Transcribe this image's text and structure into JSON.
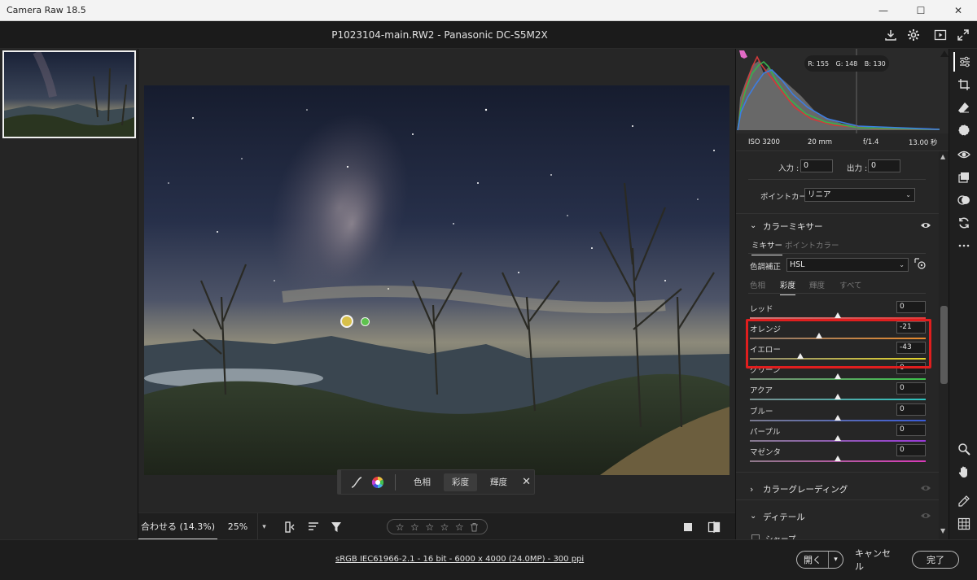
{
  "window": {
    "title": "Camera Raw 18.5",
    "controls": [
      "—",
      "☐",
      "✕"
    ]
  },
  "header": {
    "file_title": "P1023104-main.RW2  -  Panasonic DC-S5M2X"
  },
  "histogram": {
    "readout": {
      "r": "R: 155",
      "g": "G: 148",
      "b": "B: 130"
    },
    "colors": {
      "red": "#d23a3a",
      "green": "#37b24d",
      "blue": "#3d7de0",
      "fill": "#9a9a9a"
    }
  },
  "exif": {
    "iso": "ISO 3200",
    "focal": "20 mm",
    "aperture": "f/1.4",
    "shutter": "13.00 秒"
  },
  "curve": {
    "input_label": "入力 :",
    "input_value": "0",
    "output_label": "出力 :",
    "output_value": "0",
    "point_curve_label": "ポイントカーブ",
    "point_curve_value": "リニア"
  },
  "color_mixer": {
    "title": "カラーミキサー",
    "tabs": [
      {
        "label": "ミキサー",
        "active": true
      },
      {
        "label": "ポイントカラー",
        "active": false
      }
    ],
    "adjust_label": "色調補正",
    "adjust_value": "HSL",
    "subtabs": [
      {
        "label": "色相",
        "active": false
      },
      {
        "label": "彩度",
        "active": true
      },
      {
        "label": "輝度",
        "active": false
      },
      {
        "label": "すべて",
        "active": false
      }
    ],
    "sliders": [
      {
        "label": "レッド",
        "value": "0",
        "fraction": 0.5,
        "gradient": [
          "#c97979",
          "#e23b3b"
        ]
      },
      {
        "label": "オレンジ",
        "value": "-21",
        "fraction": 0.395,
        "gradient": [
          "#8a7a70",
          "#e88a2c"
        ]
      },
      {
        "label": "イエロー",
        "value": "-43",
        "fraction": 0.285,
        "gradient": [
          "#8e8a75",
          "#e6d62a"
        ]
      },
      {
        "label": "グリーン",
        "value": "0",
        "fraction": 0.5,
        "gradient": [
          "#7a8e7a",
          "#3cc24a"
        ]
      },
      {
        "label": "アクア",
        "value": "0",
        "fraction": 0.5,
        "gradient": [
          "#7a8e8e",
          "#2cc3c0"
        ]
      },
      {
        "label": "ブルー",
        "value": "0",
        "fraction": 0.5,
        "gradient": [
          "#7a7a8e",
          "#3a5cd8"
        ]
      },
      {
        "label": "パープル",
        "value": "0",
        "fraction": 0.5,
        "gradient": [
          "#857a8e",
          "#9a3ad8"
        ]
      },
      {
        "label": "マゼンタ",
        "value": "0",
        "fraction": 0.5,
        "gradient": [
          "#8e7a8a",
          "#d83ab8"
        ]
      }
    ]
  },
  "sections": [
    {
      "title": "カラーグレーディング"
    },
    {
      "title": "ディテール"
    }
  ],
  "partial_item": "シャープ",
  "mini_toolbar": {
    "buttons": [
      {
        "label": "色相",
        "active": false
      },
      {
        "label": "彩度",
        "active": true
      },
      {
        "label": "輝度",
        "active": false
      }
    ],
    "close": "✕"
  },
  "bottom_bar": {
    "fit_label": "合わせる (14.3%)",
    "zoom": "25%",
    "zoom_dropdown": "▾",
    "stars": [
      "☆",
      "☆",
      "☆",
      "☆",
      "☆"
    ]
  },
  "status": {
    "file_info": "sRGB IEC61966-2.1 - 16 bit - 6000 x 4000 (24.0MP) - 300 ppi",
    "open_label": "開く",
    "open_dropdown": "▾",
    "cancel_label": "キャンセル",
    "done_label": "完了"
  }
}
